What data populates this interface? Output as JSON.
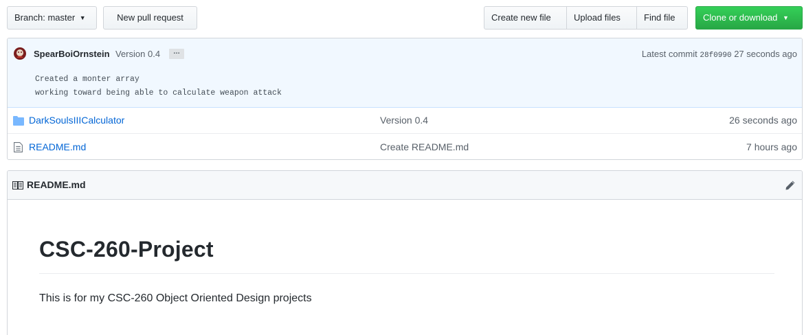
{
  "toolbar": {
    "branch_label": "Branch:",
    "branch_name": "master",
    "new_pull_request": "New pull request",
    "create_new_file": "Create new file",
    "upload_files": "Upload files",
    "find_file": "Find file",
    "clone_or_download": "Clone or download"
  },
  "commit": {
    "author": "SpearBoiOrnstein",
    "message_title": "Version 0.4",
    "ellipsis": "…",
    "latest_commit_label": "Latest commit",
    "sha": "28f0990",
    "age": "27 seconds ago",
    "description": "Created a monter array\nworking toward being able to calculate weapon attack"
  },
  "files": [
    {
      "type": "directory",
      "icon": "folder-icon",
      "name": "DarkSoulsIIICalculator",
      "message": "Version 0.4",
      "age": "26 seconds ago"
    },
    {
      "type": "file",
      "icon": "file-icon",
      "name": "README.md",
      "message": "Create README.md",
      "age": "7 hours ago"
    }
  ],
  "readme": {
    "filename": "README.md",
    "heading": "CSC-260-Project",
    "paragraph": "This is for my CSC-260 Object Oriented Design projects"
  },
  "colors": {
    "link": "#0366d6",
    "clone_button": "#28a745",
    "commit_bg": "#f1f8ff",
    "folder": "#79b8ff"
  }
}
